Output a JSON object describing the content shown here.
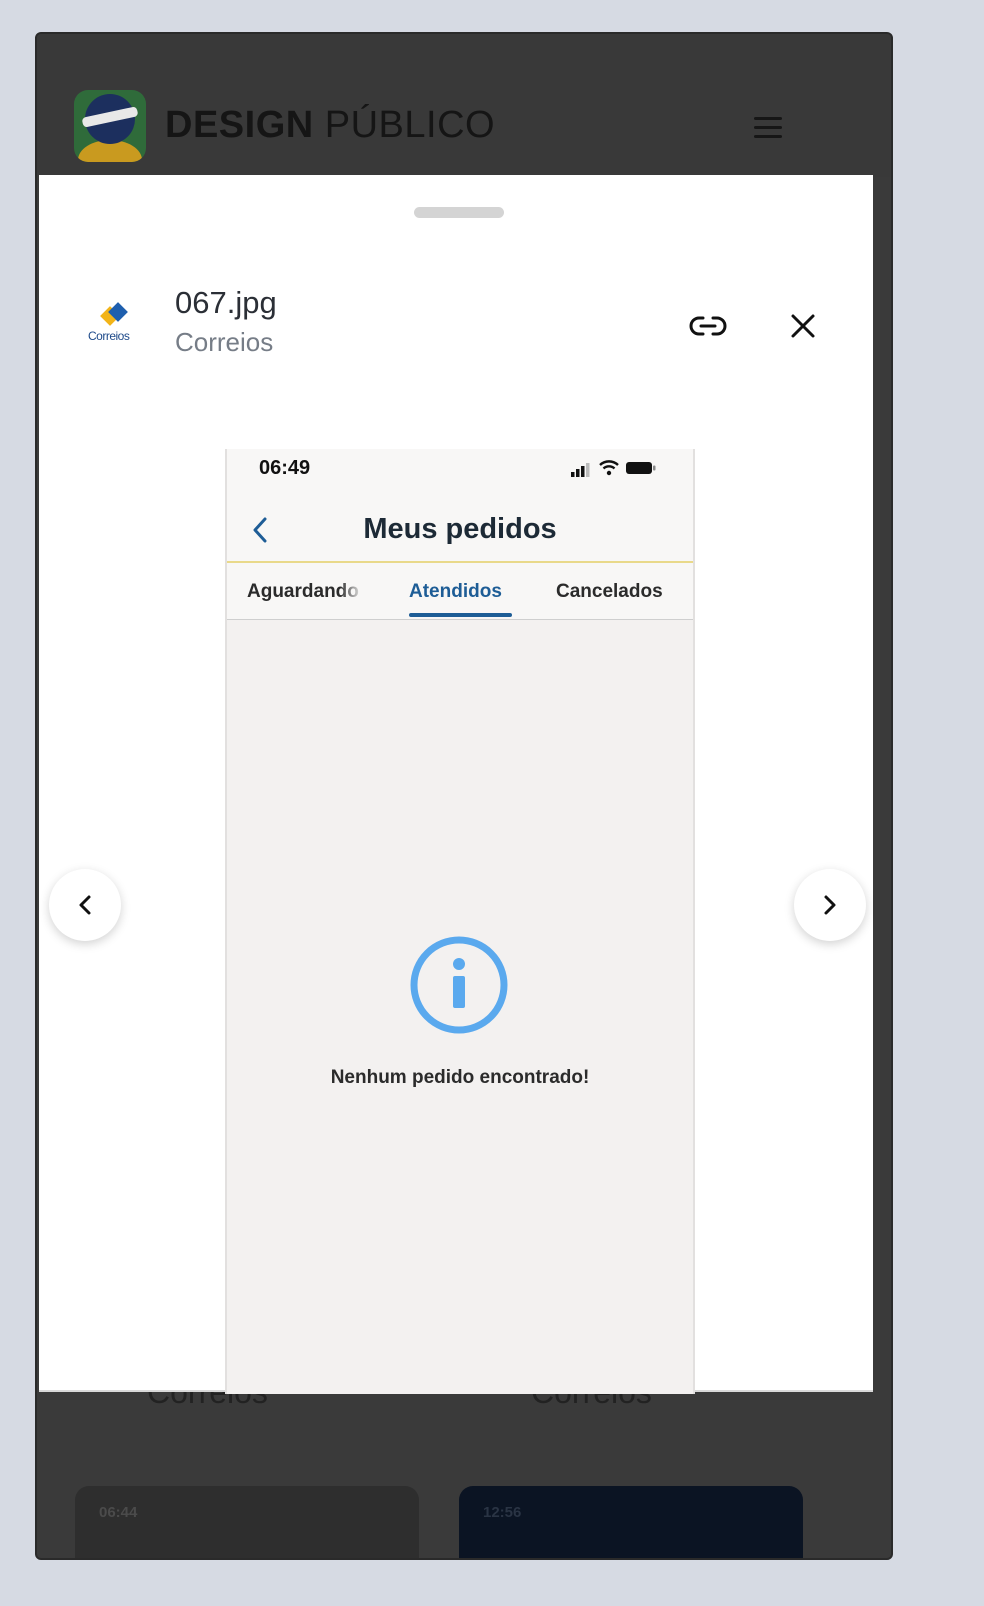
{
  "header": {
    "brand_bold": "DESIGN",
    "brand_regular": "PÚBLICO"
  },
  "sheet": {
    "file_name": "067.jpg",
    "app_name": "Correios",
    "app_icon_label": "Correios"
  },
  "screenshot": {
    "time": "06:49",
    "title": "Meus pedidos",
    "tabs": [
      "Aguardando",
      "Atendidos",
      "Cancelados"
    ],
    "active_tab": "Atendidos",
    "empty_message": "Nenhum pedido encontrado!"
  },
  "background": {
    "captions": [
      "Correios",
      "Correios"
    ],
    "cards": [
      {
        "time": "06:44"
      },
      {
        "time": "12:56"
      }
    ]
  },
  "colors": {
    "accent": "#1e5d96",
    "info_icon": "#5aa9ee",
    "header_bg": "#393939"
  }
}
